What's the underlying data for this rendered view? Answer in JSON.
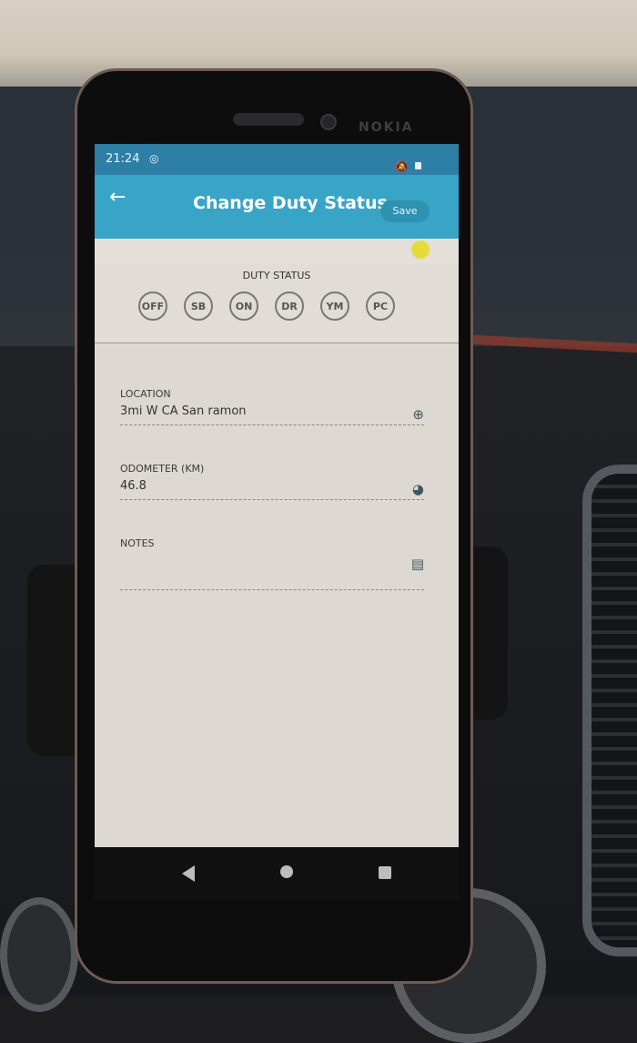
{
  "status_bar": {
    "time": "21:24"
  },
  "app_bar": {
    "title": "Change Duty Status",
    "save_label": "Save",
    "back_icon": "arrow-left-icon"
  },
  "duty_status": {
    "header": "DUTY STATUS",
    "options": [
      "OFF",
      "SB",
      "ON",
      "DR",
      "YM",
      "PC"
    ]
  },
  "form": {
    "location": {
      "label": "LOCATION",
      "value": "3mi W CA San ramon",
      "icon": "gps-target-icon"
    },
    "odometer": {
      "label": "ODOMETER (KM)",
      "value": "46.8",
      "icon": "speedometer-icon"
    },
    "notes": {
      "label": "NOTES",
      "value": "",
      "icon": "notepad-icon"
    }
  },
  "device": {
    "brand": "NOKIA"
  },
  "colors": {
    "app_bar": "#38a5c6",
    "status_bar": "#2e7fa5",
    "indicator": "#e6db3a",
    "screen_bg": "#ddd8d2"
  }
}
